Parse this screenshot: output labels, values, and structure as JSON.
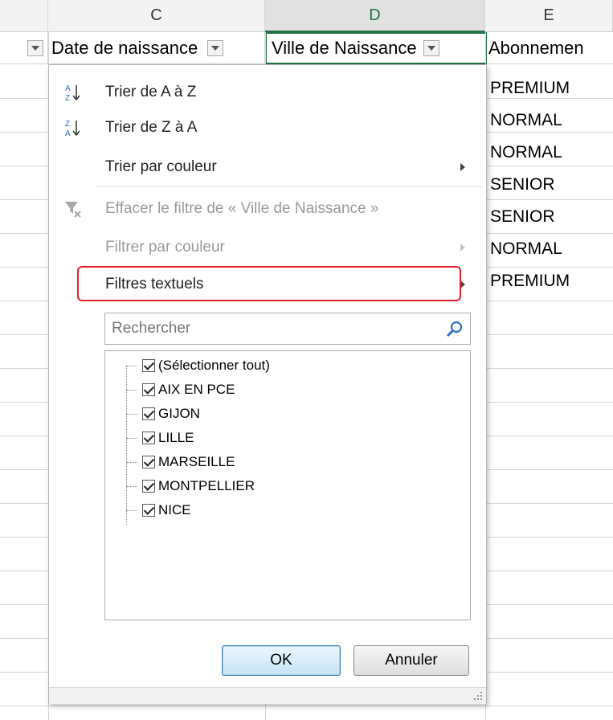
{
  "columns": {
    "c": "C",
    "d": "D",
    "e": "E"
  },
  "headers": {
    "date": "Date de naissance",
    "ville": "Ville de Naissance",
    "abonnement": "Abonnemen"
  },
  "column_e_values": [
    "PREMIUM",
    "NORMAL",
    "NORMAL",
    "SENIOR",
    "SENIOR",
    "NORMAL",
    "PREMIUM"
  ],
  "menu": {
    "sort_az": "Trier de A à Z",
    "sort_za": "Trier de Z à A",
    "sort_color": "Trier par couleur",
    "clear_filter": "Effacer le filtre de « Ville de Naissance »",
    "filter_color": "Filtrer par couleur",
    "text_filters": "Filtres textuels"
  },
  "search": {
    "placeholder": "Rechercher"
  },
  "list": [
    {
      "label": "(Sélectionner tout)",
      "checked": true
    },
    {
      "label": "AIX EN PCE",
      "checked": true
    },
    {
      "label": "GIJON",
      "checked": true
    },
    {
      "label": "LILLE",
      "checked": true
    },
    {
      "label": "MARSEILLE",
      "checked": true
    },
    {
      "label": "MONTPELLIER",
      "checked": true
    },
    {
      "label": "NICE",
      "checked": true
    }
  ],
  "buttons": {
    "ok": "OK",
    "cancel": "Annuler"
  },
  "colors": {
    "accent": "#217346",
    "highlight": "#e0222c"
  }
}
